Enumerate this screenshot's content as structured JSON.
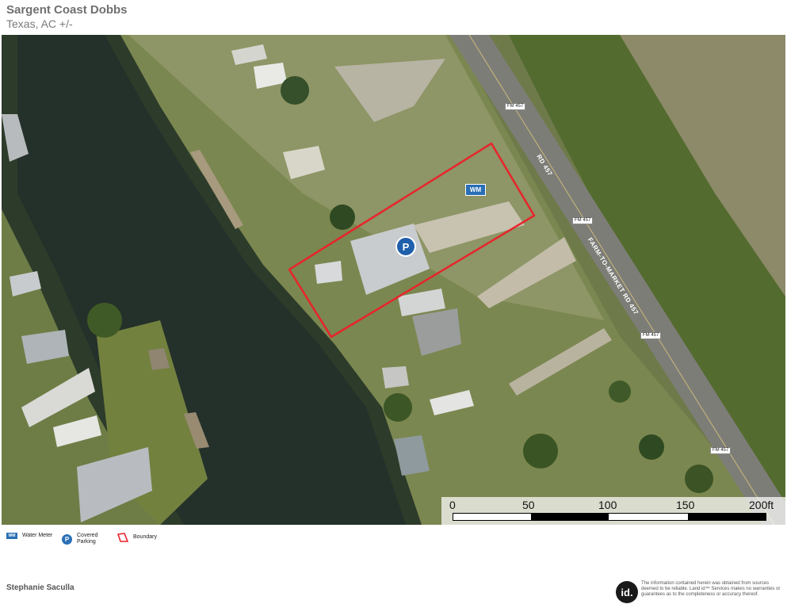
{
  "header": {
    "title": "Sargent Coast Dobbs",
    "subtitle": "Texas,  AC +/-"
  },
  "map": {
    "markers": {
      "water_meter": "WM",
      "parking": "P"
    },
    "road_labels": [
      "FM 457",
      "FM 457",
      "FM 457",
      "FM 457"
    ],
    "road_names": [
      "RD 457",
      "FARM-TO-MARKET RD 457"
    ],
    "boundary_color": "#e8242b",
    "scale": {
      "ticks": [
        "0",
        "50",
        "100",
        "150",
        "200ft"
      ]
    }
  },
  "legend": {
    "items": [
      {
        "icon": "water-meter-icon",
        "label": "Water Meter"
      },
      {
        "icon": "covered-parking-icon",
        "label": "Covered Parking"
      },
      {
        "icon": "boundary-icon",
        "label": "Boundary"
      }
    ]
  },
  "footer": {
    "agent": "Stephanie Saculla",
    "logo_text": "id.",
    "disclaimer": "The information contained herein was obtained from sources deemed to be reliable. Land id™ Services makes no warranties or guarantees as to the completeness or accuracy thereof."
  }
}
